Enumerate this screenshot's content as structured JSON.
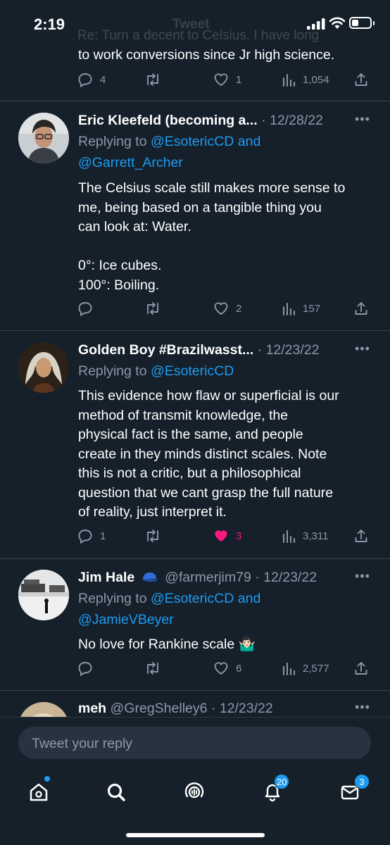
{
  "status_bar": {
    "time": "2:19",
    "ghost_text": "Re: Turn a decent to Celsius. I have long",
    "ghost_title": "Tweet"
  },
  "top_tweet": {
    "last_line": "to work conversions since Jr high science.",
    "replies": "4",
    "likes": "1",
    "views": "1,054"
  },
  "tweets": [
    {
      "name": "Eric Kleefeld (becoming a...",
      "meta": "· 12/28/22",
      "replying_prefix": "Replying to",
      "mentions_line1": "@EsotericCD and",
      "mentions_line2": "@Garrett_Archer",
      "body": [
        "The Celsius scale still makes more sense to",
        "me, being based on a tangible thing you",
        "can look at: Water.",
        "",
        "0°: Ice cubes.",
        "100°: Boiling."
      ],
      "replies": "",
      "likes": "2",
      "views": "157"
    },
    {
      "name": "Golden Boy #Brazilwasst...",
      "meta": "· 12/23/22",
      "replying_prefix": "Replying to",
      "mentions_line1": "@EsotericCD",
      "body": [
        "This evidence how flaw or superficial is our",
        "method of transmit knowledge, the",
        "physical fact is the same, and people",
        "create in they minds distinct scales. Note",
        "this is not a critic, but a philosophical",
        "question that we cant grasp the full nature",
        "of reality, just interpret it."
      ],
      "replies": "1",
      "likes": "3",
      "views": "3,311"
    },
    {
      "name": "Jim Hale",
      "handle": "@farmerjim79",
      "meta": "· 12/23/22",
      "replying_prefix": "Replying to",
      "mentions_line1": "@EsotericCD and",
      "mentions_line2": "@JamieVBeyer",
      "body": [
        "No love for Rankine scale 🤷🏻‍♂️"
      ],
      "replies": "",
      "likes": "6",
      "views": "2,577"
    },
    {
      "name": "meh",
      "handle": "@GregShelley6",
      "meta": "· 12/23/22"
    }
  ],
  "compose": {
    "placeholder": "Tweet your reply"
  },
  "tabbar": {
    "notifications_badge": "20",
    "messages_badge": "3"
  },
  "colors": {
    "background": "#15202b",
    "accent": "#1d9bf0",
    "secondary_text": "#8b98a5",
    "like_active": "#f91880",
    "divider": "#38444d"
  }
}
